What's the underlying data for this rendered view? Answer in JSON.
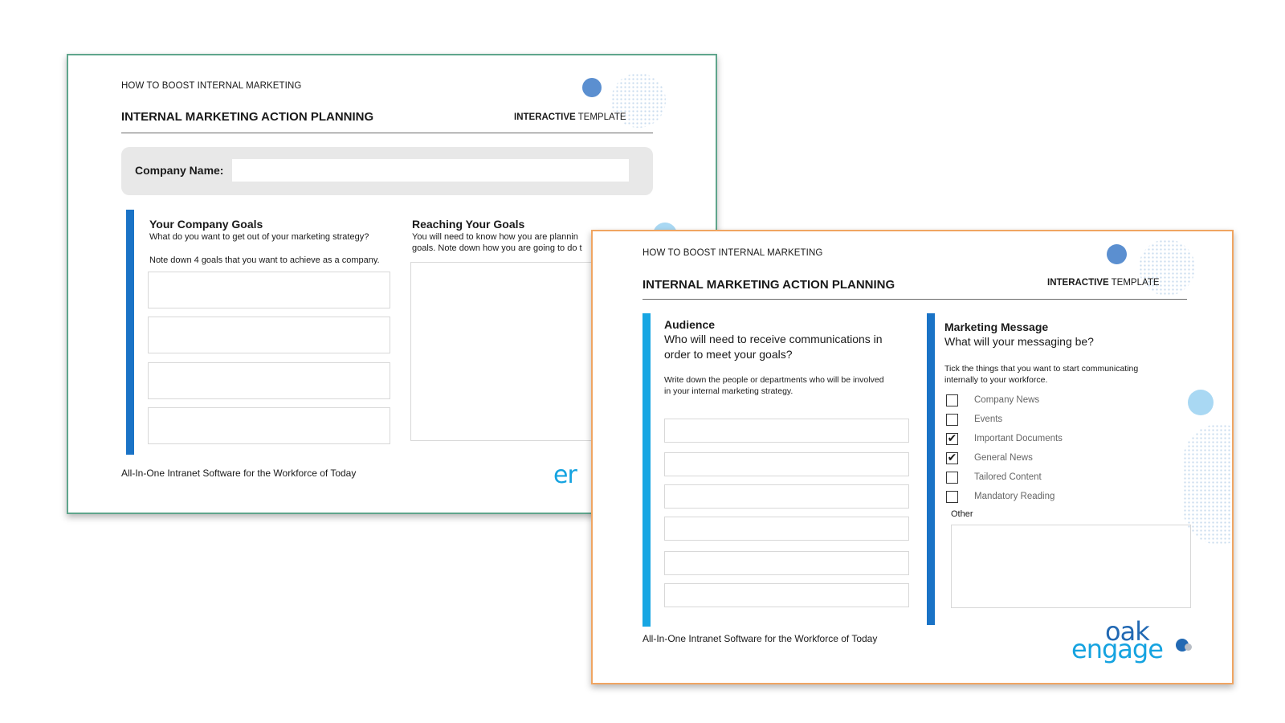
{
  "colors": {
    "accent_blue": "#1a73c6",
    "accent_cyan": "#17a6e3",
    "back_border": "#5fa58c",
    "front_border": "#f0a562",
    "panel_gray": "#e8e8e8"
  },
  "back": {
    "kicker": "HOW TO BOOST INTERNAL MARKETING",
    "title": "INTERNAL MARKETING ACTION PLANNING",
    "tag_bold": "INTERACTIVE",
    "tag_rest": " TEMPLATE",
    "company_label": "Company Name:",
    "company_value": "",
    "goals": {
      "title": "Your Company Goals",
      "subtitle": "What do you want to get out of your marketing strategy?",
      "note": "Note down 4 goals that you want to achieve as a company."
    },
    "reaching": {
      "title": "Reaching Your Goals",
      "line1": "You will need to know how you are plannin",
      "line2": "goals. Note down how you are going to do t"
    },
    "footer": "All-In-One Intranet Software for the Workforce of Today",
    "logo_fragment": "er"
  },
  "front": {
    "kicker": "HOW TO BOOST INTERNAL MARKETING",
    "title": "INTERNAL MARKETING ACTION PLANNING",
    "tag_bold": "INTERACTIVE",
    "tag_rest": " TEMPLATE",
    "audience": {
      "title": "Audience",
      "subtitle_line1": "Who will need to receive communications in",
      "subtitle_line2": "order to meet your goals?",
      "note_line1": "Write down the people or departments who will be involved",
      "note_line2": "in your internal marketing strategy."
    },
    "message": {
      "title": "Marketing Message",
      "subtitle": "What will your messaging be?",
      "note_line1": "Tick the things that you want to start communicating",
      "note_line2": "internally to your workforce.",
      "options": [
        {
          "label": "Company News",
          "mark": ""
        },
        {
          "label": "Events",
          "mark": ""
        },
        {
          "label": "Important Documents",
          "mark": "✔"
        },
        {
          "label": "General News",
          "mark": "✔"
        },
        {
          "label": "Tailored Content",
          "mark": ""
        },
        {
          "label": "Mandatory Reading",
          "mark": ""
        }
      ],
      "other_label": "Other"
    },
    "footer": "All-In-One Intranet Software for the Workforce of Today",
    "logo_top": "oak",
    "logo_bottom": "engage"
  }
}
